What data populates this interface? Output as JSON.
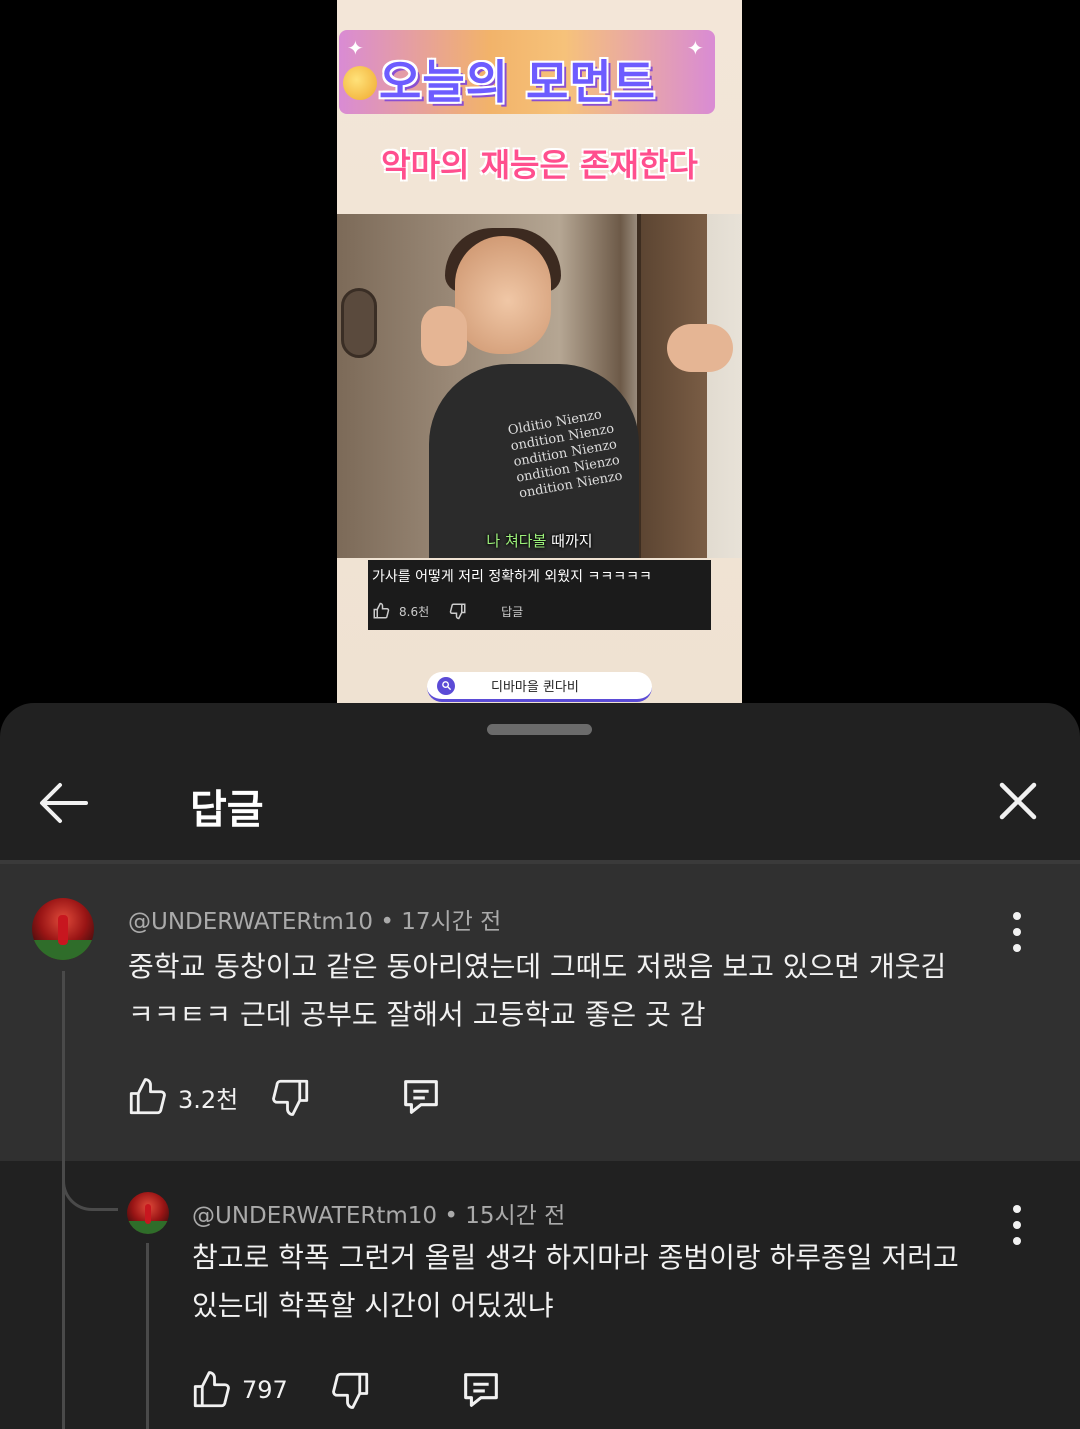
{
  "video": {
    "banner_title": "오늘의 모먼트",
    "top_subtitle": "악마의 재능은 존재한다",
    "shirt_print": "Olditio Nienzo\nondition Nienzo\nondition Nienzo\nondition Nienzo\nondition Nienzo",
    "caption_highlight": "나 쳐다볼",
    "caption_rest": " 때까지",
    "overlay_comment": {
      "text": "가사를 어떻게 저리 정확하게 외웠지 ㅋㅋㅋㅋㅋ",
      "likes": "8.6천",
      "reply_label": "답글"
    },
    "search_text": "디바마을 퀸다비"
  },
  "sheet": {
    "title": "답글"
  },
  "comments": [
    {
      "author": "@UNDERWATERtm10",
      "time": "17시간 전",
      "text_line1": "중학교 동창이고 같은 동아리였는데 그때도 저랬음 보고 있으면 개웃김",
      "text_line2": "ㅋㅋㅌㅋ 근데 공부도 잘해서 고등학교 좋은 곳 감",
      "likes": "3.2천"
    },
    {
      "author": "@UNDERWATERtm10",
      "time": "15시간 전",
      "text_line1": "참고로 학폭 그런거 올릴 생각 하지마라 종범이랑 하루종일 저러고",
      "text_line2": "있는데 학폭할 시간이 어딨겠냐",
      "likes": "797"
    }
  ],
  "meta_separator": " • ",
  "icons": {
    "back": "arrow-left-icon",
    "close": "close-icon",
    "more": "more-vertical-icon",
    "like": "thumbs-up-icon",
    "dislike": "thumbs-down-icon",
    "reply": "comment-icon"
  },
  "colors": {
    "sheet_bg": "#212121",
    "highlight_bg": "#303030",
    "meta_text": "#aaaaaa"
  }
}
